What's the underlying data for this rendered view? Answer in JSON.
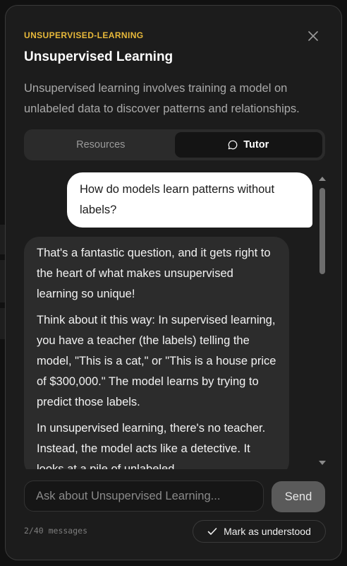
{
  "header": {
    "tag": "UNSUPERVISED-LEARNING",
    "title": "Unsupervised Learning",
    "description": "Unsupervised learning involves training a model on unlabeled data to discover patterns and relationships.",
    "close_icon": "close-icon"
  },
  "tabs": [
    {
      "label": "Resources",
      "active": false
    },
    {
      "label": "Tutor",
      "active": true,
      "icon": "chat-bubble-icon"
    }
  ],
  "chat": {
    "user_message": "How do models learn patterns without labels?",
    "assistant_paragraphs": [
      "That's a fantastic question, and it gets right to the heart of what makes unsupervised learning so unique!",
      "Think about it this way: In supervised learning, you have a teacher (the labels) telling the model, \"This is a cat,\" or \"This is a house price of $300,000.\" The model learns by trying to predict those labels.",
      "In unsupervised learning, there's no teacher. Instead, the model acts like a detective. It looks at a pile of unlabeled"
    ]
  },
  "composer": {
    "placeholder": "Ask about Unsupervised Learning...",
    "value": "",
    "send_label": "Send"
  },
  "footer": {
    "message_count": "2/40 messages",
    "mark_label": "Mark as understood",
    "mark_icon": "checkmark-icon"
  },
  "colors": {
    "accent": "#e8b93a",
    "panel_bg": "#1c1c1c",
    "bubble_user": "#ffffff",
    "bubble_assistant": "#2c2c2c"
  }
}
